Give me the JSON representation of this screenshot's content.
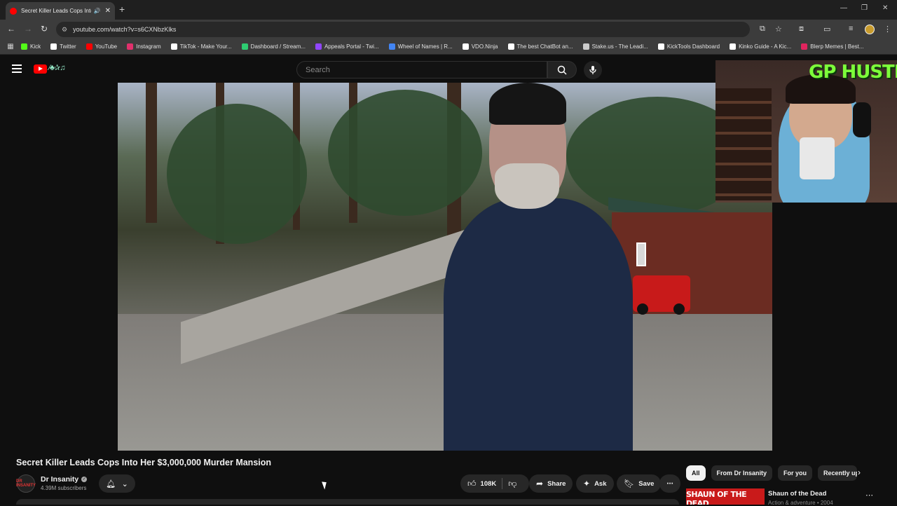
{
  "browser": {
    "tab_title": "Secret Killer Leads Cops Into Her",
    "url": "youtube.com/watch?v=s6CXNbzKlks",
    "bookmarks": [
      {
        "label": "Kick",
        "color": "#53fc18"
      },
      {
        "label": "Twitter",
        "color": "#ffffff"
      },
      {
        "label": "YouTube",
        "color": "#ff0000"
      },
      {
        "label": "Instagram",
        "color": "#e1306c"
      },
      {
        "label": "TikTok - Make Your...",
        "color": "#ffffff"
      },
      {
        "label": "Dashboard / Stream...",
        "color": "#2ecc71"
      },
      {
        "label": "Appeals Portal - Twi...",
        "color": "#9146ff"
      },
      {
        "label": "Wheel of Names | R...",
        "color": "#4285f4"
      },
      {
        "label": "VDO.Ninja",
        "color": "#ffffff"
      },
      {
        "label": "The best ChatBot an...",
        "color": "#ffffff"
      },
      {
        "label": "Stake.us - The Leadi...",
        "color": "#cccccc"
      },
      {
        "label": "KickTools Dashboard",
        "color": "#ffffff"
      },
      {
        "label": "Kinko Guide - A Kic...",
        "color": "#ffffff"
      },
      {
        "label": "Blerp Memes | Best...",
        "color": "#e0245e"
      }
    ]
  },
  "youtube": {
    "search_placeholder": "Search",
    "doodle": "∕♣✰♫",
    "webcam_overlay_text": "GP HUSTLA",
    "video_title": "Secret Killer Leads Cops Into Her $3,000,000 Murder Mansion",
    "channel_name": "Dr Insanity",
    "channel_avatar_text": "DR INSANITY",
    "subscribers": "4.39M subscribers",
    "likes": "108K",
    "share_label": "Share",
    "ask_label": "Ask",
    "save_label": "Save",
    "chips": [
      "All",
      "From Dr Insanity",
      "For you",
      "Recently up"
    ],
    "recommended": {
      "thumb_text": "SHAUN OF THE DEAD",
      "title": "Shaun of the Dead",
      "meta": "Action & adventure • 2004"
    }
  },
  "colors": {
    "accent": "#ff0000",
    "background": "#0f0f0f",
    "overlay_text": "#7dff3a"
  }
}
